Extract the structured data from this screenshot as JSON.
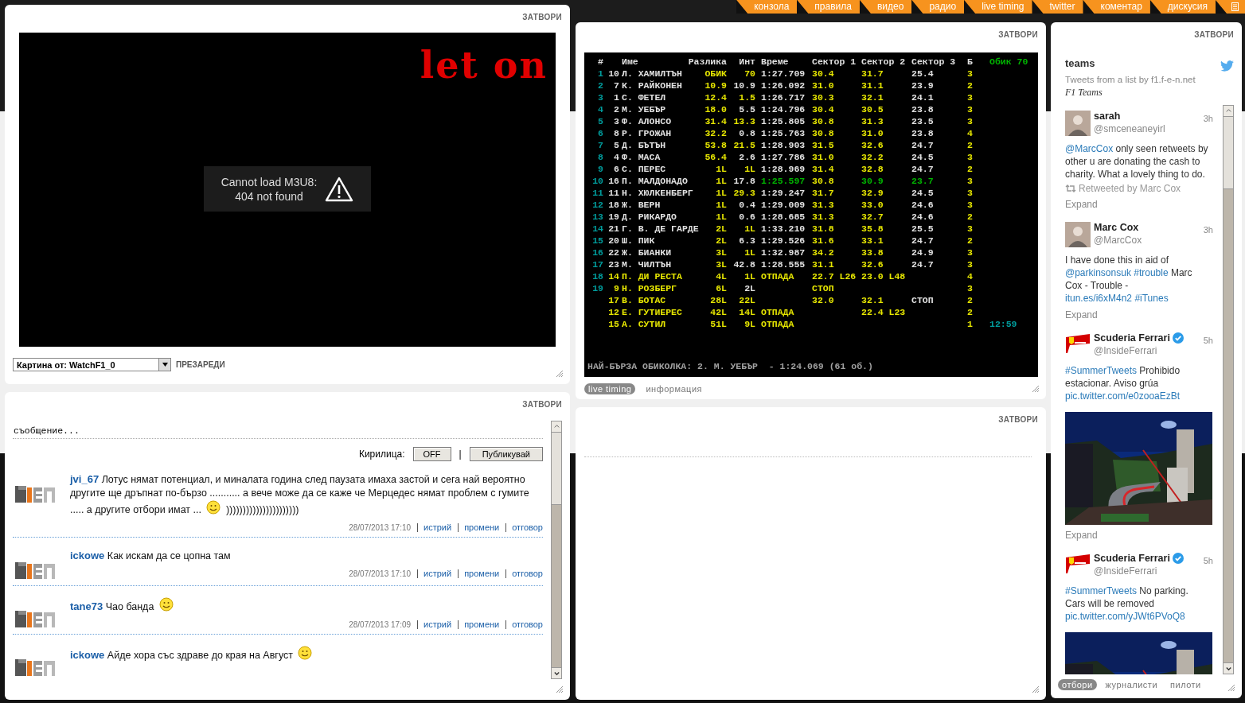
{
  "nav": {
    "tabs": [
      "конзола",
      "правила",
      "видео",
      "радио",
      "live timing",
      "twitter",
      "коментар",
      "дискусия"
    ]
  },
  "video_panel": {
    "close": "ЗАТВОРИ",
    "logo": "let on",
    "error": "Cannot load M3U8:\n404 not found",
    "source_select": {
      "value": "Картина от: WatchF1_0"
    },
    "reload": "ПРЕЗАРЕДИ"
  },
  "timing_panel": {
    "close": "ЗАТВОРИ",
    "headers": [
      "#",
      "Име",
      "Разлика",
      "Инт",
      "Време",
      "Сектор 1",
      "Сектор 2",
      "Сектор 3",
      "Б"
    ],
    "lap_counter": "Обик 70",
    "rows": [
      {
        "pos": {
          "text": "1",
          "color": "#009c9c"
        },
        "car": {
          "text": "10",
          "color": "#e0e0e0"
        },
        "name": {
          "text": "Л. ХАМИЛТЪН",
          "color": "#e0e0e0"
        },
        "gap": {
          "text": "ОБИК",
          "color": "#e6e600"
        },
        "int": {
          "text": "70",
          "color": "#e6e600"
        },
        "time": {
          "text": "1:27.709",
          "color": "#e0e0e0"
        },
        "s1": {
          "text": "30.4",
          "color": "#e6e600"
        },
        "s2": {
          "text": "31.7",
          "color": "#e6e600"
        },
        "s3": {
          "text": "25.4",
          "color": "#e0e0e0"
        },
        "pits": {
          "text": "3",
          "color": "#e6e600"
        }
      },
      {
        "pos": {
          "text": "2",
          "color": "#009c9c"
        },
        "car": {
          "text": "7",
          "color": "#e0e0e0"
        },
        "name": {
          "text": "К. РАЙКОНЕН",
          "color": "#e0e0e0"
        },
        "gap": {
          "text": "10.9",
          "color": "#e6e600"
        },
        "int": {
          "text": "10.9",
          "color": "#e0e0e0"
        },
        "time": {
          "text": "1:26.092",
          "color": "#e0e0e0"
        },
        "s1": {
          "text": "31.0",
          "color": "#e6e600"
        },
        "s2": {
          "text": "31.1",
          "color": "#e6e600"
        },
        "s3": {
          "text": "23.9",
          "color": "#e0e0e0"
        },
        "pits": {
          "text": "2",
          "color": "#e6e600"
        }
      },
      {
        "pos": {
          "text": "3",
          "color": "#009c9c"
        },
        "car": {
          "text": "1",
          "color": "#e0e0e0"
        },
        "name": {
          "text": "С. ФЕТЕЛ",
          "color": "#e0e0e0"
        },
        "gap": {
          "text": "12.4",
          "color": "#e6e600"
        },
        "int": {
          "text": "1.5",
          "color": "#e6e600"
        },
        "time": {
          "text": "1:26.717",
          "color": "#e0e0e0"
        },
        "s1": {
          "text": "30.3",
          "color": "#e6e600"
        },
        "s2": {
          "text": "32.1",
          "color": "#e6e600"
        },
        "s3": {
          "text": "24.1",
          "color": "#e0e0e0"
        },
        "pits": {
          "text": "3",
          "color": "#e6e600"
        }
      },
      {
        "pos": {
          "text": "4",
          "color": "#009c9c"
        },
        "car": {
          "text": "2",
          "color": "#e0e0e0"
        },
        "name": {
          "text": "М. УЕБЪР",
          "color": "#e0e0e0"
        },
        "gap": {
          "text": "18.0",
          "color": "#e6e600"
        },
        "int": {
          "text": "5.5",
          "color": "#e0e0e0"
        },
        "time": {
          "text": "1:24.796",
          "color": "#e0e0e0"
        },
        "s1": {
          "text": "30.4",
          "color": "#e6e600"
        },
        "s2": {
          "text": "30.5",
          "color": "#e6e600"
        },
        "s3": {
          "text": "23.8",
          "color": "#e0e0e0"
        },
        "pits": {
          "text": "3",
          "color": "#e6e600"
        }
      },
      {
        "pos": {
          "text": "5",
          "color": "#009c9c"
        },
        "car": {
          "text": "3",
          "color": "#e0e0e0"
        },
        "name": {
          "text": "Ф. АЛОНСО",
          "color": "#e0e0e0"
        },
        "gap": {
          "text": "31.4",
          "color": "#e6e600"
        },
        "int": {
          "text": "13.3",
          "color": "#e6e600"
        },
        "time": {
          "text": "1:25.805",
          "color": "#e0e0e0"
        },
        "s1": {
          "text": "30.8",
          "color": "#e6e600"
        },
        "s2": {
          "text": "31.3",
          "color": "#e6e600"
        },
        "s3": {
          "text": "23.5",
          "color": "#e0e0e0"
        },
        "pits": {
          "text": "3",
          "color": "#e6e600"
        }
      },
      {
        "pos": {
          "text": "6",
          "color": "#009c9c"
        },
        "car": {
          "text": "8",
          "color": "#e0e0e0"
        },
        "name": {
          "text": "Р. ГРОЖАН",
          "color": "#e0e0e0"
        },
        "gap": {
          "text": "32.2",
          "color": "#e6e600"
        },
        "int": {
          "text": "0.8",
          "color": "#e0e0e0"
        },
        "time": {
          "text": "1:25.763",
          "color": "#e0e0e0"
        },
        "s1": {
          "text": "30.8",
          "color": "#e6e600"
        },
        "s2": {
          "text": "31.0",
          "color": "#e6e600"
        },
        "s3": {
          "text": "23.8",
          "color": "#e0e0e0"
        },
        "pits": {
          "text": "4",
          "color": "#e6e600"
        }
      },
      {
        "pos": {
          "text": "7",
          "color": "#009c9c"
        },
        "car": {
          "text": "5",
          "color": "#e0e0e0"
        },
        "name": {
          "text": "Д. БЪТЪН",
          "color": "#e0e0e0"
        },
        "gap": {
          "text": "53.8",
          "color": "#e6e600"
        },
        "int": {
          "text": "21.5",
          "color": "#e6e600"
        },
        "time": {
          "text": "1:28.903",
          "color": "#e0e0e0"
        },
        "s1": {
          "text": "31.5",
          "color": "#e6e600"
        },
        "s2": {
          "text": "32.6",
          "color": "#e6e600"
        },
        "s3": {
          "text": "24.7",
          "color": "#e0e0e0"
        },
        "pits": {
          "text": "2",
          "color": "#e6e600"
        }
      },
      {
        "pos": {
          "text": "8",
          "color": "#009c9c"
        },
        "car": {
          "text": "4",
          "color": "#e0e0e0"
        },
        "name": {
          "text": "Ф. МАСА",
          "color": "#e0e0e0"
        },
        "gap": {
          "text": "56.4",
          "color": "#e6e600"
        },
        "int": {
          "text": "2.6",
          "color": "#e0e0e0"
        },
        "time": {
          "text": "1:27.786",
          "color": "#e0e0e0"
        },
        "s1": {
          "text": "31.0",
          "color": "#e6e600"
        },
        "s2": {
          "text": "32.2",
          "color": "#e6e600"
        },
        "s3": {
          "text": "24.5",
          "color": "#e0e0e0"
        },
        "pits": {
          "text": "3",
          "color": "#e6e600"
        }
      },
      {
        "pos": {
          "text": "9",
          "color": "#009c9c"
        },
        "car": {
          "text": "6",
          "color": "#e0e0e0"
        },
        "name": {
          "text": "С. ПЕРЕС",
          "color": "#e0e0e0"
        },
        "gap": {
          "text": "1L",
          "color": "#e6e600"
        },
        "int": {
          "text": "1L",
          "color": "#e6e600"
        },
        "time": {
          "text": "1:28.969",
          "color": "#e0e0e0"
        },
        "s1": {
          "text": "31.4",
          "color": "#e6e600"
        },
        "s2": {
          "text": "32.8",
          "color": "#e6e600"
        },
        "s3": {
          "text": "24.7",
          "color": "#e0e0e0"
        },
        "pits": {
          "text": "2",
          "color": "#e6e600"
        }
      },
      {
        "pos": {
          "text": "10",
          "color": "#009c9c"
        },
        "car": {
          "text": "16",
          "color": "#e0e0e0"
        },
        "name": {
          "text": "П. МАЛДОНАДО",
          "color": "#e0e0e0"
        },
        "gap": {
          "text": "1L",
          "color": "#e6e600"
        },
        "int": {
          "text": "17.8",
          "color": "#e0e0e0"
        },
        "time": {
          "text": "1:25.597",
          "color": "#00b400"
        },
        "s1": {
          "text": "30.8",
          "color": "#e6e600"
        },
        "s2": {
          "text": "30.9",
          "color": "#00b400"
        },
        "s3": {
          "text": "23.7",
          "color": "#00b400"
        },
        "pits": {
          "text": "3",
          "color": "#e6e600"
        }
      },
      {
        "pos": {
          "text": "11",
          "color": "#009c9c"
        },
        "car": {
          "text": "11",
          "color": "#e0e0e0"
        },
        "name": {
          "text": "Н. ХЮЛКЕНБЕРГ",
          "color": "#e0e0e0"
        },
        "gap": {
          "text": "1L",
          "color": "#e6e600"
        },
        "int": {
          "text": "29.3",
          "color": "#e6e600"
        },
        "time": {
          "text": "1:29.247",
          "color": "#e0e0e0"
        },
        "s1": {
          "text": "31.7",
          "color": "#e6e600"
        },
        "s2": {
          "text": "32.9",
          "color": "#e6e600"
        },
        "s3": {
          "text": "24.5",
          "color": "#e0e0e0"
        },
        "pits": {
          "text": "3",
          "color": "#e6e600"
        }
      },
      {
        "pos": {
          "text": "12",
          "color": "#009c9c"
        },
        "car": {
          "text": "18",
          "color": "#e0e0e0"
        },
        "name": {
          "text": "Ж. ВЕРН",
          "color": "#e0e0e0"
        },
        "gap": {
          "text": "1L",
          "color": "#e6e600"
        },
        "int": {
          "text": "0.4",
          "color": "#e0e0e0"
        },
        "time": {
          "text": "1:29.009",
          "color": "#e0e0e0"
        },
        "s1": {
          "text": "31.3",
          "color": "#e6e600"
        },
        "s2": {
          "text": "33.0",
          "color": "#e6e600"
        },
        "s3": {
          "text": "24.6",
          "color": "#e0e0e0"
        },
        "pits": {
          "text": "3",
          "color": "#e6e600"
        }
      },
      {
        "pos": {
          "text": "13",
          "color": "#009c9c"
        },
        "car": {
          "text": "19",
          "color": "#e0e0e0"
        },
        "name": {
          "text": "Д. РИКАРДО",
          "color": "#e0e0e0"
        },
        "gap": {
          "text": "1L",
          "color": "#e6e600"
        },
        "int": {
          "text": "0.6",
          "color": "#e0e0e0"
        },
        "time": {
          "text": "1:28.685",
          "color": "#e0e0e0"
        },
        "s1": {
          "text": "31.3",
          "color": "#e6e600"
        },
        "s2": {
          "text": "32.7",
          "color": "#e6e600"
        },
        "s3": {
          "text": "24.6",
          "color": "#e0e0e0"
        },
        "pits": {
          "text": "2",
          "color": "#e6e600"
        }
      },
      {
        "pos": {
          "text": "14",
          "color": "#009c9c"
        },
        "car": {
          "text": "21",
          "color": "#e0e0e0"
        },
        "name": {
          "text": "Г. В. ДЕ ГАРДЕ",
          "color": "#e0e0e0"
        },
        "gap": {
          "text": "2L",
          "color": "#e6e600"
        },
        "int": {
          "text": "1L",
          "color": "#e6e600"
        },
        "time": {
          "text": "1:33.210",
          "color": "#e0e0e0"
        },
        "s1": {
          "text": "31.8",
          "color": "#e6e600"
        },
        "s2": {
          "text": "35.8",
          "color": "#e6e600"
        },
        "s3": {
          "text": "25.5",
          "color": "#e0e0e0"
        },
        "pits": {
          "text": "3",
          "color": "#e6e600"
        }
      },
      {
        "pos": {
          "text": "15",
          "color": "#009c9c"
        },
        "car": {
          "text": "20",
          "color": "#e0e0e0"
        },
        "name": {
          "text": "Ш. ПИК",
          "color": "#e0e0e0"
        },
        "gap": {
          "text": "2L",
          "color": "#e6e600"
        },
        "int": {
          "text": "6.3",
          "color": "#e0e0e0"
        },
        "time": {
          "text": "1:29.526",
          "color": "#e0e0e0"
        },
        "s1": {
          "text": "31.6",
          "color": "#e6e600"
        },
        "s2": {
          "text": "33.1",
          "color": "#e6e600"
        },
        "s3": {
          "text": "24.7",
          "color": "#e0e0e0"
        },
        "pits": {
          "text": "2",
          "color": "#e6e600"
        }
      },
      {
        "pos": {
          "text": "16",
          "color": "#009c9c"
        },
        "car": {
          "text": "22",
          "color": "#e0e0e0"
        },
        "name": {
          "text": "Ж. БИАНКИ",
          "color": "#e0e0e0"
        },
        "gap": {
          "text": "3L",
          "color": "#e6e600"
        },
        "int": {
          "text": "1L",
          "color": "#e6e600"
        },
        "time": {
          "text": "1:32.987",
          "color": "#e0e0e0"
        },
        "s1": {
          "text": "34.2",
          "color": "#e6e600"
        },
        "s2": {
          "text": "33.8",
          "color": "#e6e600"
        },
        "s3": {
          "text": "24.9",
          "color": "#e0e0e0"
        },
        "pits": {
          "text": "3",
          "color": "#e6e600"
        }
      },
      {
        "pos": {
          "text": "17",
          "color": "#009c9c"
        },
        "car": {
          "text": "23",
          "color": "#e0e0e0"
        },
        "name": {
          "text": "М. ЧИЛТЪН",
          "color": "#e0e0e0"
        },
        "gap": {
          "text": "3L",
          "color": "#e6e600"
        },
        "int": {
          "text": "42.8",
          "color": "#e0e0e0"
        },
        "time": {
          "text": "1:28.555",
          "color": "#e0e0e0"
        },
        "s1": {
          "text": "31.1",
          "color": "#e6e600"
        },
        "s2": {
          "text": "32.6",
          "color": "#e6e600"
        },
        "s3": {
          "text": "24.7",
          "color": "#e0e0e0"
        },
        "pits": {
          "text": "3",
          "color": "#e6e600"
        }
      },
      {
        "pos": {
          "text": "18",
          "color": "#009c9c"
        },
        "car": {
          "text": "14",
          "color": "#e6e600"
        },
        "name": {
          "text": "П. ДИ РЕСТА",
          "color": "#e6e600"
        },
        "gap": {
          "text": "4L",
          "color": "#e6e600"
        },
        "int": {
          "text": "1L",
          "color": "#e6e600"
        },
        "time": {
          "text": "ОТПАДА",
          "color": "#e6e600"
        },
        "s1": {
          "text": "22.7 L26",
          "color": "#e6e600"
        },
        "s2": {
          "text": "23.0 L48",
          "color": "#e6e600"
        },
        "pits": {
          "text": "4",
          "color": "#e6e600"
        }
      },
      {
        "pos": {
          "text": "19",
          "color": "#009c9c"
        },
        "car": {
          "text": "9",
          "color": "#e6e600"
        },
        "name": {
          "text": "Н. РОЗБЕРГ",
          "color": "#e6e600"
        },
        "gap": {
          "text": "6L",
          "color": "#e6e600"
        },
        "int": {
          "text": "2L",
          "color": "#e0e0e0"
        },
        "s1": {
          "text": "СТОП",
          "color": "#e6e600"
        },
        "pits": {
          "text": "3",
          "color": "#e6e600"
        }
      },
      {
        "car": {
          "text": "17",
          "color": "#e6e600"
        },
        "name": {
          "text": "В. БОТАС",
          "color": "#e6e600"
        },
        "gap": {
          "text": "28L",
          "color": "#e6e600"
        },
        "int": {
          "text": "22L",
          "color": "#e6e600"
        },
        "s1": {
          "text": "32.0",
          "color": "#e6e600"
        },
        "s2": {
          "text": "32.1",
          "color": "#e6e600"
        },
        "s3": {
          "text": "СТОП",
          "color": "#e0e0e0"
        },
        "pits": {
          "text": "2",
          "color": "#e6e600"
        }
      },
      {
        "car": {
          "text": "12",
          "color": "#e6e600"
        },
        "name": {
          "text": "Е. ГУТИЕРЕС",
          "color": "#e6e600"
        },
        "gap": {
          "text": "42L",
          "color": "#e6e600"
        },
        "int": {
          "text": "14L",
          "color": "#e6e600"
        },
        "time": {
          "text": "ОТПАДА",
          "color": "#e6e600"
        },
        "s2": {
          "text": "22.4 L23",
          "color": "#e6e600"
        },
        "pits": {
          "text": "2",
          "color": "#e6e600"
        }
      },
      {
        "car": {
          "text": "15",
          "color": "#e6e600"
        },
        "name": {
          "text": "А. СУТИЛ",
          "color": "#e6e600"
        },
        "gap": {
          "text": "51L",
          "color": "#e6e600"
        },
        "int": {
          "text": "9L",
          "color": "#e6e600"
        },
        "time": {
          "text": "ОТПАДА",
          "color": "#e6e600"
        },
        "pits": {
          "text": "1",
          "color": "#e6e600"
        },
        "extra": {
          "text": "12:59",
          "color": "#009c9c"
        }
      }
    ],
    "fastest_lap": "НАЙ-БЪРЗА ОБИКОЛКА: 2. М. УЕБЪР  - 1:24.069 (61 об.)",
    "tabs": [
      {
        "label": "live timing",
        "selected": true
      },
      {
        "label": "информация",
        "selected": false
      }
    ]
  },
  "chat_panel": {
    "close": "ЗАТВОРИ",
    "message_field": {
      "placeholder": "съобщение..."
    },
    "cyrillic_label": "Кирилица:",
    "cyrillic_toggle": "OFF",
    "separator": "|",
    "publish": "Публикувай",
    "messages": [
      {
        "user": "jvi_67",
        "text": "Лотус нямат потенциал, и миналата година след паузата имаха застой и сега най вероятно другите ще дръпнат по-бързо ........... а вече може да се каже че Мерцедес нямат проблем с гумите ..... а другите отбори имат ...",
        "smiley": true,
        "after": "))))))))))))))))))))))",
        "date": "28/07/2013 17:10",
        "actions": [
          "истрий",
          "промени",
          "отговор"
        ]
      },
      {
        "user": "ickowe",
        "text": "Как искам да се цопна там",
        "smiley": false,
        "date": "28/07/2013 17:10",
        "actions": [
          "истрий",
          "промени",
          "отговор"
        ]
      },
      {
        "user": "tane73",
        "text": "Чао банда",
        "smiley": true,
        "date": "28/07/2013 17:09",
        "actions": [
          "истрий",
          "промени",
          "отговор"
        ]
      },
      {
        "user": "ickowe",
        "text": "Айде хора със здраве до края на Август",
        "smiley": true
      }
    ]
  },
  "empty_panel": {
    "close": "ЗАТВОРИ"
  },
  "twitter_panel": {
    "close": "ЗАТВОРИ",
    "title": "teams",
    "subtitle": "Tweets from a list by f1.f-e-n.net",
    "list_name": "F1 Teams",
    "tweets": [
      {
        "avatar": {
          "kind": "person"
        },
        "name": "sarah",
        "verified": false,
        "handle": "@smceneaneyirl",
        "time": "3h",
        "segments": [
          {
            "text": "@MarcCox",
            "link": true
          },
          {
            "text": " only seen retweets by other u are donating the cash to charity. What a lovely thing to do.",
            "link": false
          }
        ],
        "retweeted": "Retweeted by Marc Cox",
        "expand": "Expand"
      },
      {
        "avatar": {
          "kind": "person"
        },
        "name": "Marc Cox",
        "verified": false,
        "handle": "@MarcCox",
        "time": "3h",
        "segments": [
          {
            "text": "I have done this in aid of ",
            "link": false
          },
          {
            "text": "@parkinsonsuk #trouble",
            "link": true
          },
          {
            "text": " Marc Cox - Trouble - ",
            "link": false
          },
          {
            "text": "itun.es/i6xM4n2 #iTunes",
            "link": true
          }
        ],
        "expand": "Expand"
      },
      {
        "avatar": {
          "kind": "crest"
        },
        "name": "Scuderia Ferrari",
        "verified": true,
        "handle": "@InsideFerrari",
        "time": "5h",
        "segments": [
          {
            "text": "#SummerTweets",
            "link": true
          },
          {
            "text": " Prohibido estacionar. Aviso grúa ",
            "link": false
          },
          {
            "text": "pic.twitter.com/e0zooaEzBt",
            "link": true
          }
        ],
        "media": {
          "kind": "picture"
        },
        "expand": "Expand"
      },
      {
        "avatar": {
          "kind": "crest"
        },
        "name": "Scuderia Ferrari",
        "verified": true,
        "handle": "@InsideFerrari",
        "time": "5h",
        "segments": [
          {
            "text": "#SummerTweets",
            "link": true
          },
          {
            "text": " No parking. Cars will be removed ",
            "link": false
          },
          {
            "text": "pic.twitter.com/yJWt6PVoQ8",
            "link": true
          }
        ],
        "media": {
          "kind": "picture"
        }
      }
    ],
    "tabs": [
      {
        "label": "отбори",
        "selected": true
      },
      {
        "label": "журналисти",
        "selected": false
      },
      {
        "label": "пилоти",
        "selected": false
      }
    ]
  }
}
